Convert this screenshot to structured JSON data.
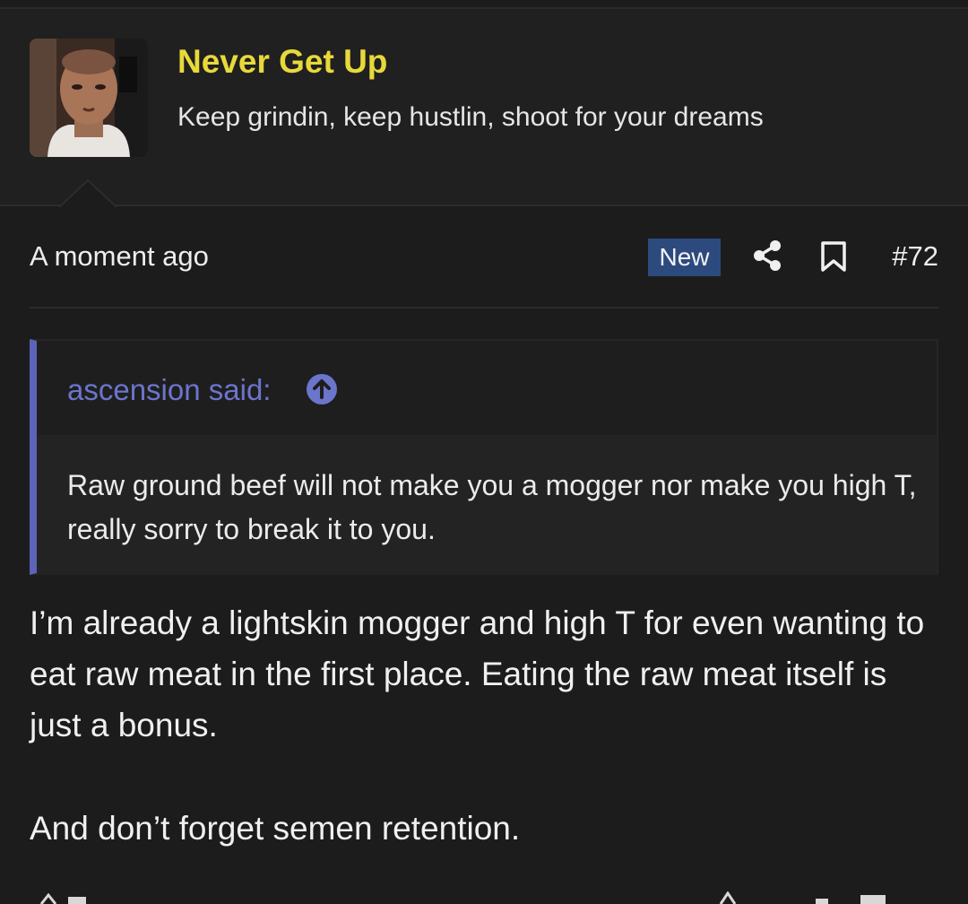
{
  "author": {
    "name": "Never Get Up",
    "user_title": "Keep grindin, keep hustlin, shoot for your dreams"
  },
  "meta": {
    "timestamp": "A moment ago",
    "badge": "New",
    "post_number": "#72",
    "icons": [
      "share-icon",
      "bookmark-icon"
    ]
  },
  "quote": {
    "author_label": "ascension said:",
    "icon": "arrow-up-circle-icon",
    "text": "Raw ground beef will not make you a mogger nor make you high T, really sorry to break it to you."
  },
  "message": {
    "paragraphs": [
      "I’m already a lightskin mogger and high T for even wanting to eat raw meat in the first place. Eating the raw meat itself is just a bonus.",
      "And don’t forget semen retention."
    ]
  },
  "colors": {
    "background": "#1c1c1c",
    "username": "#e8d93a",
    "quote_accent": "#5b64b8",
    "badge_bg": "#2d4a7e"
  }
}
